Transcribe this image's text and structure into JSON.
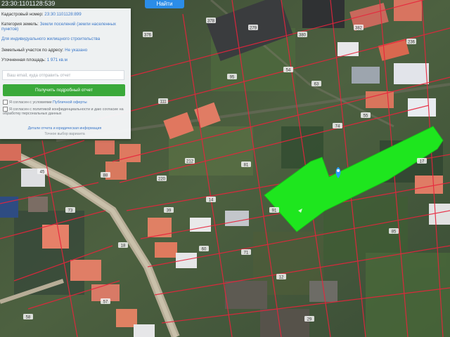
{
  "top": {
    "coords": "23:30:1101128:539",
    "find_button": "Найти"
  },
  "panel": {
    "cadastral_label": "Кадастровый номер:",
    "cadastral_value": "23:30:1101128:899",
    "category_label": "Категория земель:",
    "category_value": "Земли поселений (земли населенных пунктов)",
    "purpose_value": "Для индивидуального жилищного строительства",
    "address_label": "Земельный участок по адресу:",
    "address_value": "Не указано",
    "area_label": "Уточненная площадь:",
    "area_value": "1 971 кв.м",
    "input_placeholder": "Ваш email, куда отправить отчет",
    "cta_label": "Получить подробный отчет",
    "check1_text": "Я согласен с условиями",
    "check1_link": "Публичной оферты",
    "check2_text": "Я согласен с политикой конфиденциальности и даю согласие на обработку персональных данных",
    "footer_link": "Детали отчета и юридическая информация",
    "footer_sub": "Точное выбор варианта"
  },
  "map": {
    "plot_color": "#1ee61e",
    "marker_color": "#2a9df4",
    "boundary_color": "#e8243c",
    "labels": [
      "376",
      "378",
      "279",
      "380",
      "382",
      "236",
      "111",
      "95",
      "63",
      "74",
      "55",
      "54",
      "212",
      "220",
      "88",
      "45",
      "73",
      "18",
      "39",
      "14",
      "81",
      "91",
      "57",
      "58",
      "60",
      "71",
      "12",
      "85",
      "17",
      "29"
    ]
  }
}
